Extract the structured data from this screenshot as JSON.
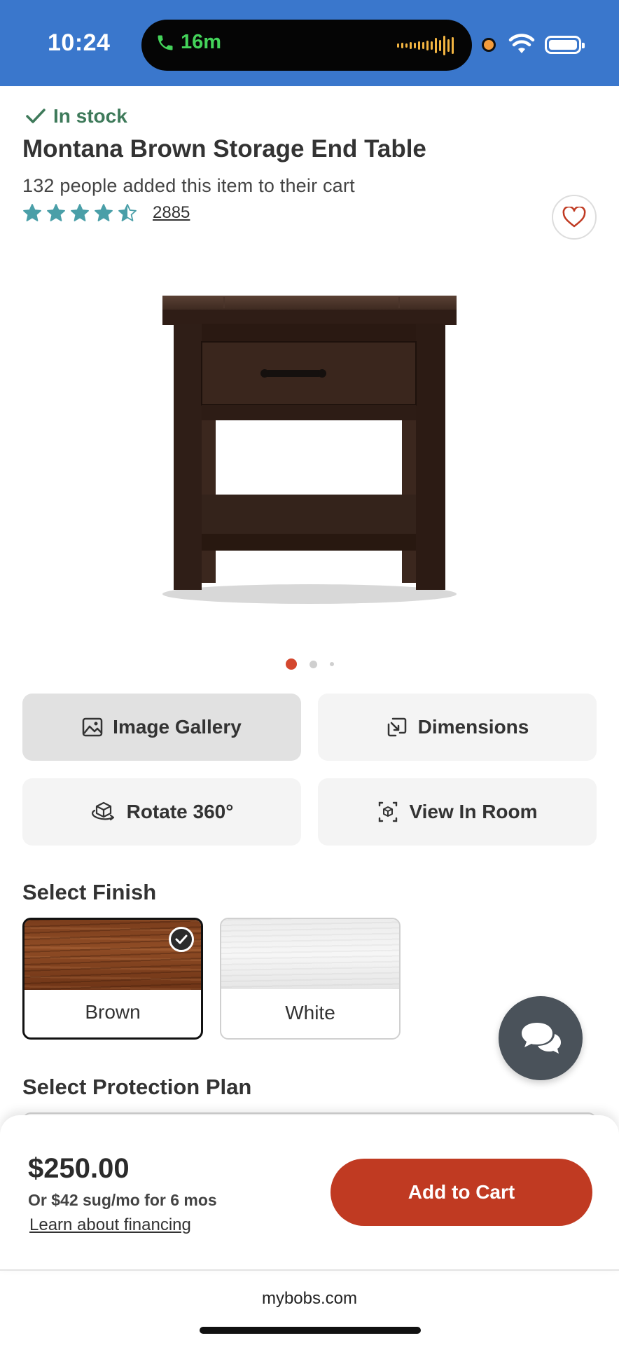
{
  "status_bar": {
    "time": "10:24",
    "call_duration": "16m",
    "icons": [
      "phone-icon",
      "waveform-icon",
      "recording-dot-icon",
      "wifi-icon",
      "battery-icon"
    ],
    "colors": {
      "background": "#3a77cc",
      "call": "#44d35a",
      "waveform": "#f2b441",
      "recording": "#f39c3c"
    }
  },
  "product": {
    "stock_status": "In stock",
    "title": "Montana Brown Storage End Table",
    "cart_social_proof": "132 people added this item to their cart",
    "rating": 4.5,
    "rating_max": 5,
    "review_count": "2885",
    "image_count": 3,
    "current_image_index": 0
  },
  "actions": {
    "image_gallery": "Image Gallery",
    "dimensions": "Dimensions",
    "rotate": "Rotate 360°",
    "view_in_room": "View In Room"
  },
  "finish": {
    "heading": "Select Finish",
    "options": [
      {
        "label": "Brown",
        "selected": true
      },
      {
        "label": "White",
        "selected": false
      }
    ]
  },
  "protection": {
    "heading": "Select Protection Plan"
  },
  "purchase": {
    "price": "$250.00",
    "financing": "Or $42 sug/mo for 6 mos",
    "learn_link": "Learn about financing",
    "add_to_cart": "Add to Cart"
  },
  "browser": {
    "url": "mybobs.com"
  },
  "colors": {
    "accent": "#c03a22",
    "rating_star": "#4a9fa8",
    "stock_green": "#3e7a5a",
    "chat_button": "#4a525a"
  }
}
